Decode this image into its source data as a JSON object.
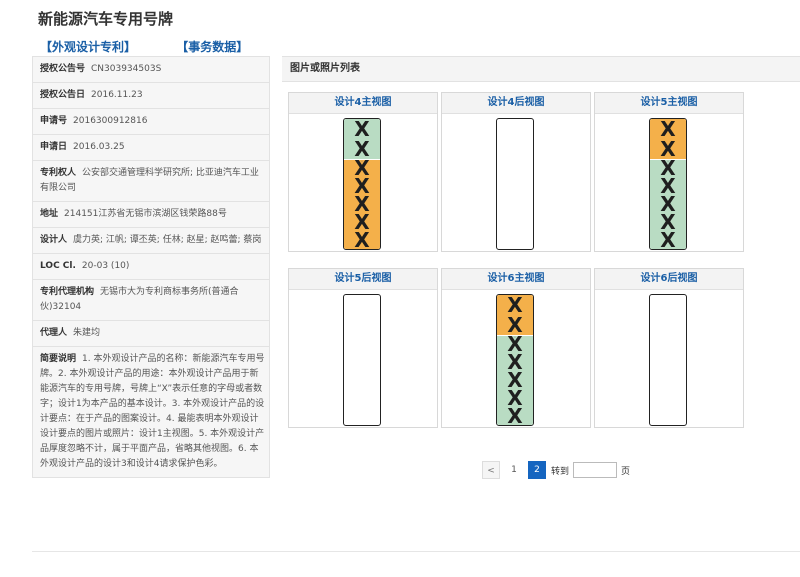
{
  "page_title": "新能源汽车专用号牌",
  "tabs": [
    "【外观设计专利】",
    "【事务数据】"
  ],
  "details": [
    {
      "label": "授权公告号",
      "value": "CN303934503S"
    },
    {
      "label": "授权公告日",
      "value": "2016.11.23"
    },
    {
      "label": "申请号",
      "value": "2016300912816"
    },
    {
      "label": "申请日",
      "value": "2016.03.25"
    },
    {
      "label": "专利权人",
      "value": "公安部交通管理科学研究所; 比亚迪汽车工业有限公司"
    },
    {
      "label": "地址",
      "value": "214151江苏省无锡市滨湖区钱荣路88号"
    },
    {
      "label": "设计人",
      "value": "虞力英; 江帆; 谭丕英; 任林; 赵星; 赵鸣蕾; 蔡岗"
    },
    {
      "label": "LOC Cl.",
      "value": "20-03 (10)"
    },
    {
      "label": "专利代理机构",
      "value": "无锡市大为专利商标事务所(普通合伙)32104"
    },
    {
      "label": "代理人",
      "value": "朱建均"
    },
    {
      "label": "简要说明",
      "value": "1. 本外观设计产品的名称：新能源汽车专用号牌。2. 本外观设计产品的用途：本外观设计产品用于新能源汽车的专用号牌，号牌上“X”表示任意的字母或者数字；设计1为本产品的基本设计。3. 本外观设计产品的设计要点：在于产品的图案设计。4. 最能表明本外观设计设计要点的图片或照片：设计1主视图。5. 本外观设计产品厚度忽略不计，属于平面产品，省略其他视图。6. 本外观设计产品的设计3和设计4请求保护色彩。"
    }
  ],
  "images_panel": {
    "title": "图片或照片列表",
    "items": [
      {
        "caption": "设计4主视图",
        "type": "front",
        "top_color": "#b9dcc3",
        "bottom_color": "#f4b04a",
        "top_xs": "XX",
        "bottom_xs": "XXXXX"
      },
      {
        "caption": "设计4后视图",
        "type": "back"
      },
      {
        "caption": "设计5主视图",
        "type": "front",
        "top_color": "#f4b04a",
        "bottom_color": "#b9dcc3",
        "top_xs": "XX",
        "bottom_xs": "XXXXX"
      },
      {
        "caption": "设计5后视图",
        "type": "back"
      },
      {
        "caption": "设计6主视图",
        "type": "front",
        "top_color": "#f4b04a",
        "bottom_color": "#b9dcc3",
        "top_xs": "XX",
        "bottom_xs": "XXXXX"
      },
      {
        "caption": "设计6后视图",
        "type": "back"
      }
    ]
  },
  "pagination": {
    "prev": "<",
    "pages": [
      "1",
      "2"
    ],
    "current": "2",
    "goto_label": "转到",
    "goto_value": "",
    "page_suffix": "页"
  }
}
